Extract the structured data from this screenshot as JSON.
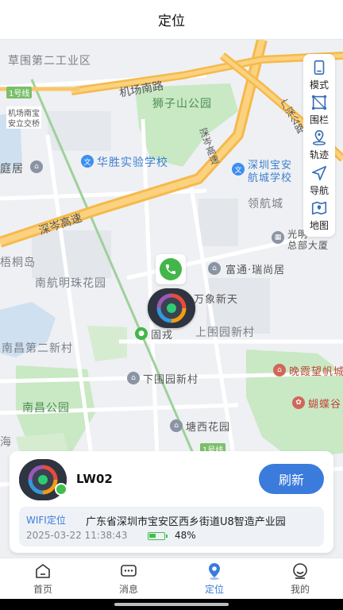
{
  "header": {
    "title": "定位"
  },
  "map": {
    "labels": {
      "caowei": "草围第二工业区",
      "airport_south": "机场南路",
      "shizishan": "狮子山公园",
      "huasheng": "华胜实验学校",
      "shenzhen_baoan_1": "深圳宝安",
      "shenzhen_baoan_2": "航城学校",
      "linghang": "领航城",
      "guangshen": "广深公路",
      "shencen_vertical": "深岑高速",
      "shencen": "深岑高速",
      "wutong": "梧桐岛",
      "nanhang": "南航明珠花园",
      "futong": "富通·瑞尚居",
      "wanxiang": "万象新天",
      "guangming_1": "光明",
      "guangming_2": "总部大厦",
      "nanchang2": "南昌第二新村",
      "gurong": "固戎",
      "shangweiyuan": "上围园新村",
      "xiaweiyuan": "下围园新村",
      "wanxia": "晚霞望帆城",
      "hudie": "蝴蝶谷",
      "nanchang_park": "南昌公园",
      "tangxi": "塘西花园",
      "tingju": "庭居",
      "jichang_1": "机场南宝",
      "jichang_2": "安立交桥",
      "line1": "1号线",
      "line1_b": "1号线",
      "hai": "海"
    }
  },
  "tools": [
    {
      "label": "模式",
      "icon": "mode-icon"
    },
    {
      "label": "围栏",
      "icon": "fence-icon"
    },
    {
      "label": "轨迹",
      "icon": "track-icon"
    },
    {
      "label": "导航",
      "icon": "navigate-icon"
    },
    {
      "label": "地图",
      "icon": "map-icon"
    }
  ],
  "device": {
    "name": "LW02",
    "refresh_label": "刷新",
    "location_type": "WIFI定位",
    "address": "广东省深圳市宝安区西乡街道U8智造产业园",
    "time": "2025-03-22 11:38:43",
    "battery": "48%",
    "battery_level": 0.48
  },
  "nav": [
    {
      "label": "首页",
      "icon": "home-icon",
      "active": false
    },
    {
      "label": "消息",
      "icon": "message-icon",
      "active": false
    },
    {
      "label": "定位",
      "icon": "location-icon",
      "active": true
    },
    {
      "label": "我的",
      "icon": "profile-icon",
      "active": false
    }
  ],
  "colors": {
    "accent": "#3a7bdc",
    "online": "#3fbf4d",
    "highway": "#f6b94a",
    "park": "#c9e8c4"
  }
}
